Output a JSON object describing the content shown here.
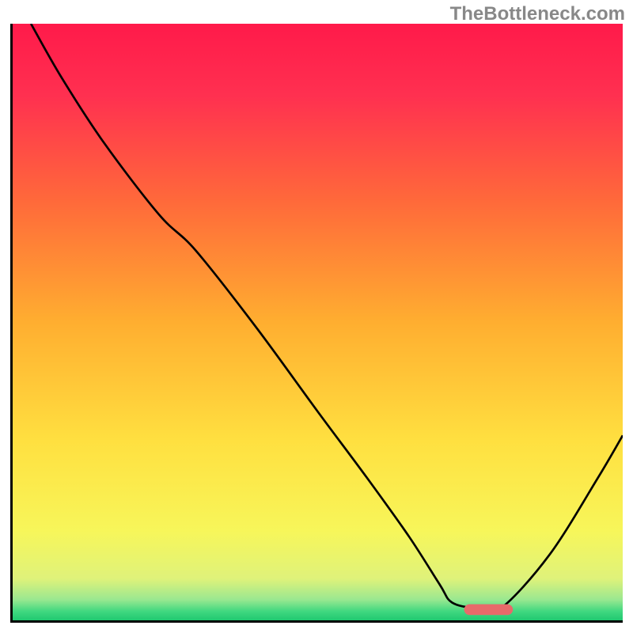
{
  "watermark": "TheBottleneck.com",
  "chart_data": {
    "type": "line",
    "title": "",
    "xlabel": "",
    "ylabel": "",
    "xlim": [
      0,
      100
    ],
    "ylim": [
      0,
      100
    ],
    "gradient_stops": [
      {
        "offset": 0.0,
        "color": "#ff1a4a"
      },
      {
        "offset": 0.12,
        "color": "#ff3050"
      },
      {
        "offset": 0.3,
        "color": "#ff6a3a"
      },
      {
        "offset": 0.5,
        "color": "#ffae30"
      },
      {
        "offset": 0.7,
        "color": "#ffe040"
      },
      {
        "offset": 0.85,
        "color": "#f7f65a"
      },
      {
        "offset": 0.93,
        "color": "#dff27a"
      },
      {
        "offset": 0.965,
        "color": "#9ae890"
      },
      {
        "offset": 0.985,
        "color": "#40d880"
      },
      {
        "offset": 1.0,
        "color": "#20c870"
      }
    ],
    "series": [
      {
        "name": "bottleneck-curve",
        "color": "#000000",
        "x": [
          3,
          8,
          15,
          24,
          30,
          40,
          50,
          58,
          65,
          70,
          72,
          76,
          80,
          88,
          96,
          100
        ],
        "y": [
          100,
          91,
          80,
          68,
          62,
          49,
          35,
          24,
          14,
          6,
          3,
          2,
          2,
          11,
          24,
          31
        ]
      }
    ],
    "marker": {
      "x_start": 74,
      "x_end": 82,
      "y": 1.8,
      "color": "#e86a6a"
    }
  }
}
